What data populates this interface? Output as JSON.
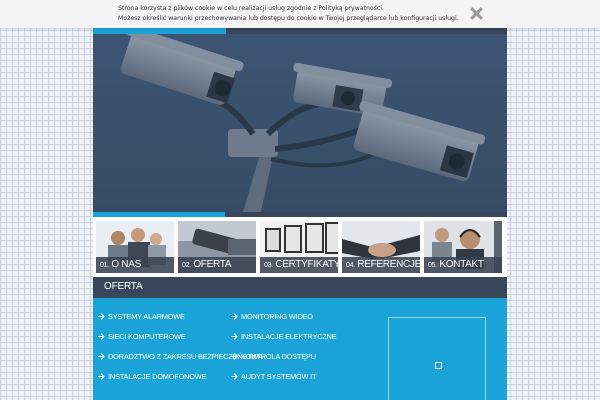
{
  "cookie": {
    "line1": "Strona korzysta z plików cookie w celu realizacji usług zgodnie z Polityką prywatności.",
    "line2": "Możesz określić warunki przechowywania lub dostępu do cookie w Twojej przeglądarce lub konfiguracji usługi.",
    "close_icon": "close-icon"
  },
  "hero": {
    "image": "security-cameras",
    "slide_progress": 0.32
  },
  "nav_tiles": [
    {
      "num": "01.",
      "label": "O NAS",
      "image": "business-team"
    },
    {
      "num": "02.",
      "label": "OFERTA",
      "image": "security-camera"
    },
    {
      "num": "03.",
      "label": "CERTYFIKATY",
      "image": "certificate-frames"
    },
    {
      "num": "04.",
      "label": "REFERENCJE",
      "image": "handshake"
    },
    {
      "num": "05.",
      "label": "KONTAKT",
      "image": "call-center"
    }
  ],
  "offer": {
    "title": "OFERTA",
    "col1": [
      "SYSTEMY ALARMOWE",
      "SIECI KOMPUTEROWE",
      "DORADZTWO Z ZAKRESU BEZPIECZEŃSTWA",
      "INSTALACJE DOMOFONOWE"
    ],
    "col2": [
      "MONITORING WIDEO",
      "INSTALACJE ELEKTRYCZNE",
      "KONTROLA DOSTĘPU",
      "AUDYT SYSTEMÓW IT"
    ],
    "arrow_icon": "arrow-right-icon",
    "image_placeholder_icon": "broken-image-icon"
  },
  "colors": {
    "accent": "#1aa3d9",
    "dark": "#374659",
    "hero": "#3b5271"
  }
}
